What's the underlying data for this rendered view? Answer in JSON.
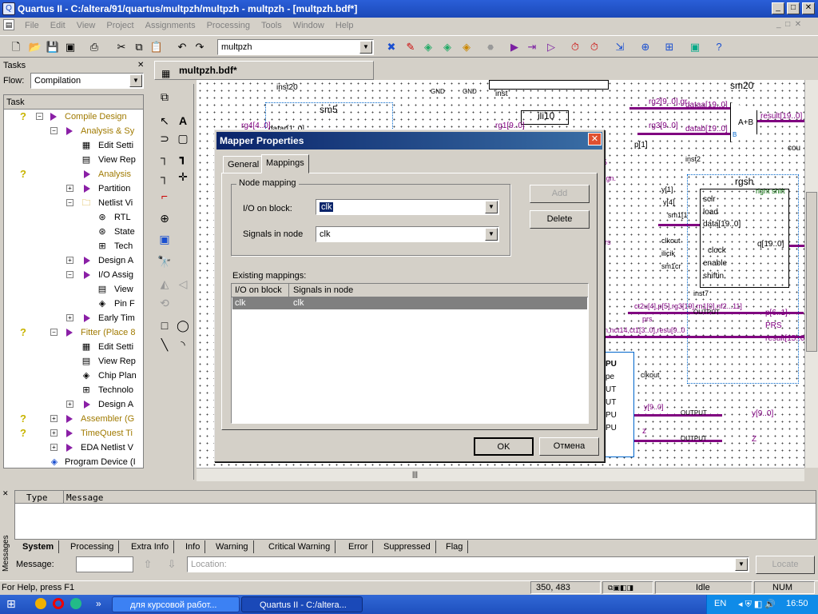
{
  "window": {
    "title": "Quartus II - C:/altera/91/quartus/multpzh/multpzh - multpzh - [multpzh.bdf*]"
  },
  "menu": [
    "File",
    "Edit",
    "View",
    "Project",
    "Assignments",
    "Processing",
    "Tools",
    "Window",
    "Help"
  ],
  "toolbar": {
    "project_combo": "multpzh"
  },
  "tasks": {
    "header": "Tasks",
    "flow_label": "Flow:",
    "flow_value": "Compilation",
    "column": "Task"
  },
  "task_items": [
    "Compile Design",
    "Analysis & Sy",
    "Edit Setti",
    "View Rep",
    "Analysis",
    "Partition",
    "Netlist Vi",
    "RTL",
    "State",
    "Tech",
    "Design A",
    "I/O Assig",
    "View",
    "Pin F",
    "Early Tim",
    "Fitter (Place 8",
    "Edit Setti",
    "View Rep",
    "Chip Plan",
    "Technolo",
    "Design A",
    "Assembler (G",
    "TimeQuest Ti",
    "EDA Netlist V",
    "Program Device (I"
  ],
  "doc_tab": "multpzh.bdf*",
  "schematic": {
    "labels": [
      "inst20",
      "GND",
      "GND",
      "inst",
      "sm20",
      "sm5",
      "ili10",
      "rg2[9..0],gr",
      "dataa[19..0]",
      "A",
      "A+B",
      "result[19..0]",
      "rg3[9..0]",
      "datab[19..0]",
      "B",
      "cou",
      "inst2",
      "p[1]",
      "datar[1..0]",
      "rg4[4..0]",
      "rg1[9..0]",
      "rgsh",
      "right shift",
      "y[1]",
      "sclr",
      "y[4]",
      "load",
      "sm1[1",
      "data[19..0]",
      "clkout",
      "clock",
      "q[19..0]",
      "ilicik",
      "enable",
      "sm1cr",
      "shiftin",
      "inst7",
      "ct2u[4],p[5],rg3[19],rn1[0],nf2...11]",
      "p[6..1]",
      "OUTPUT",
      "prs",
      "PRS",
      "result[15..0]",
      "n,nct14,ct1[3..0],resu[9..0",
      "clkout",
      "y[9..0]",
      "z",
      "OUTPUT",
      "y[9..0]",
      "OUTPUT",
      "Z",
      "sign.",
      "ors",
      "25",
      "pe",
      "UT",
      "UT",
      "PU",
      "PU",
      "PU"
    ]
  },
  "dialog": {
    "title": "Mapper Properties",
    "tabs": [
      "General",
      "Mappings"
    ],
    "node_mapping_label": "Node mapping",
    "io_label": "I/O on block:",
    "io_value": "clk",
    "signals_label": "Signals in node",
    "signals_value": "clk",
    "add_label": "Add",
    "delete_label": "Delete",
    "existing_label": "Existing mappings:",
    "col_io": "I/O on block",
    "col_signals": "Signals in node",
    "rows": [
      {
        "io": "clk",
        "signals": "clk"
      }
    ],
    "ok_label": "OK",
    "cancel_label": "Отмена"
  },
  "messages": {
    "col_type": "Type",
    "col_message": "Message",
    "side_label": "Messages",
    "tabs": [
      "System",
      "Processing",
      "Extra Info",
      "Info",
      "Warning",
      "Critical Warning",
      "Error",
      "Suppressed",
      "Flag"
    ],
    "message_label": "Message:",
    "location_placeholder": "Location:",
    "locate_label": "Locate"
  },
  "status": {
    "help": "For Help, press F1",
    "coords": "350, 483",
    "state": "Idle",
    "num": "NUM"
  },
  "taskbar": {
    "item1": "для курсовой работ...",
    "item2": "Quartus II - C:/altera...",
    "lang": "EN",
    "clock": "16:50"
  },
  "colors": {
    "title_blue": "#1b48b8",
    "dialog_title": "#0a246a",
    "bus_purple": "#800080",
    "task_yellow": "#c8b400"
  }
}
